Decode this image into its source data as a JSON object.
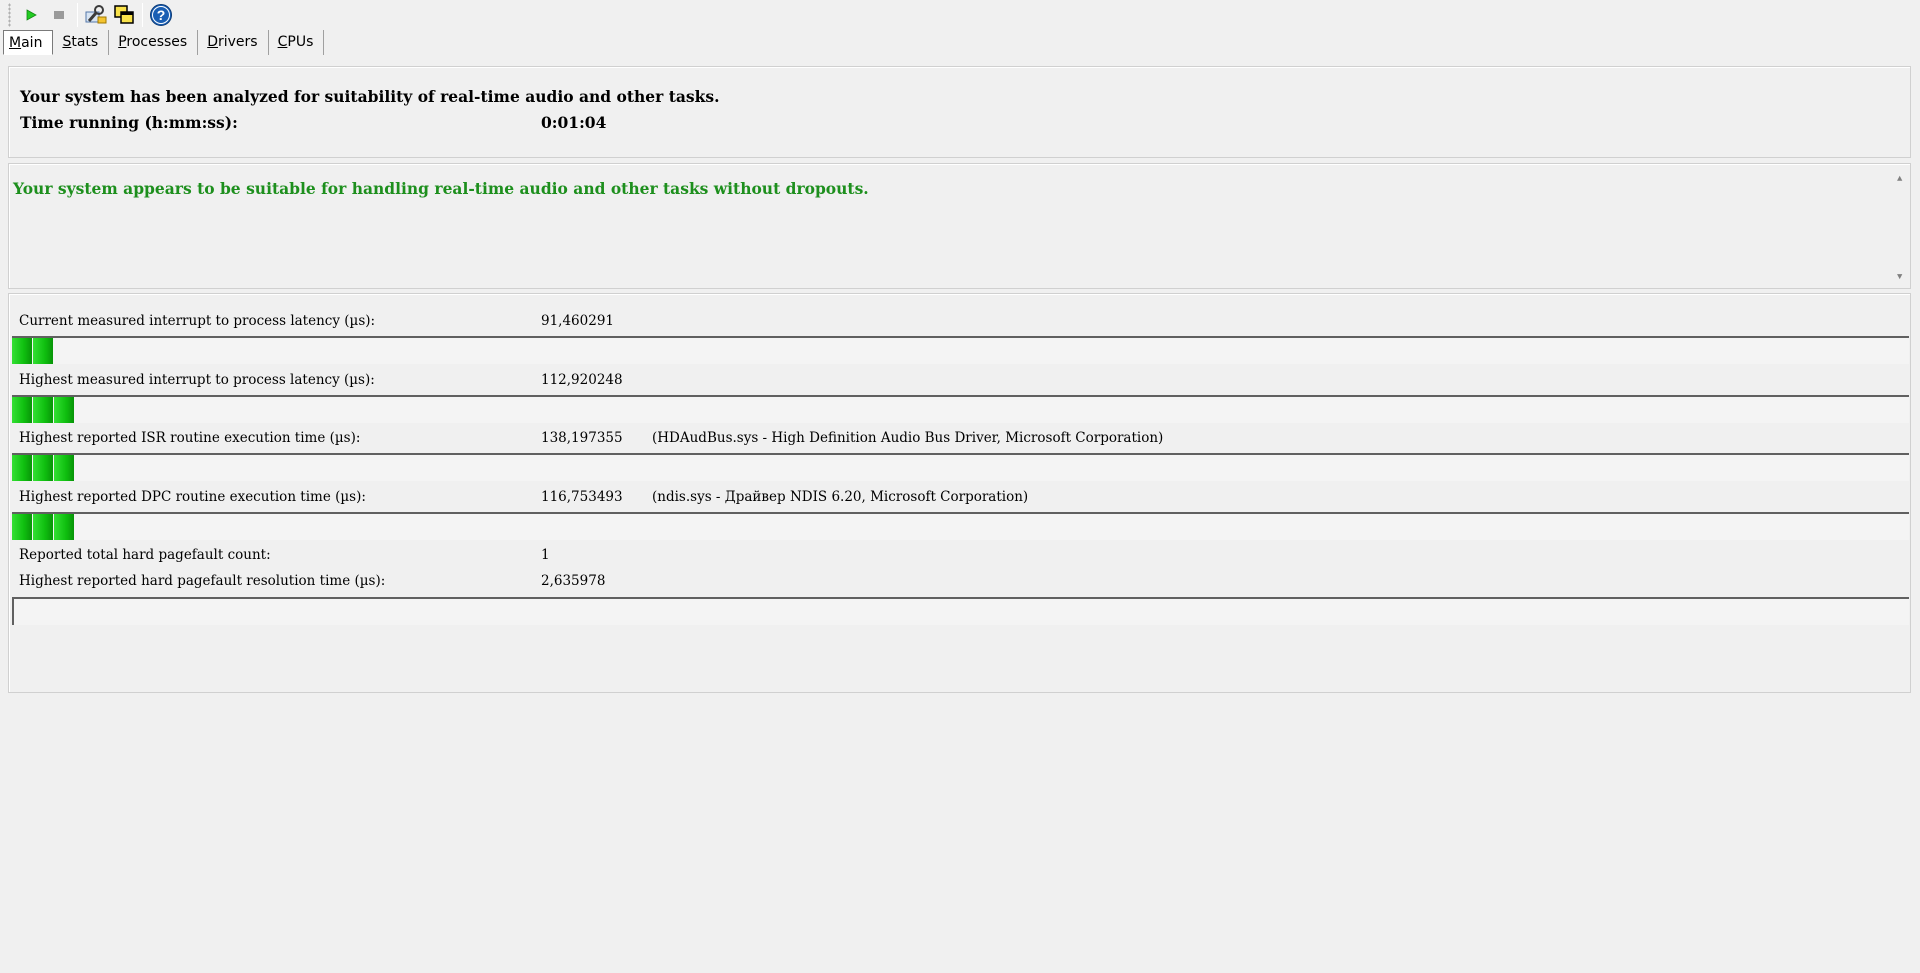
{
  "toolbar": {
    "buttons": [
      {
        "name": "start-icon",
        "color": "#22aa22"
      },
      {
        "name": "stop-icon",
        "color": "#909090"
      },
      {
        "name": "tools-icon"
      },
      {
        "name": "windows-icon"
      },
      {
        "name": "help-icon",
        "color": "#1a5fb4"
      }
    ]
  },
  "tabs": [
    {
      "key": "M",
      "rest": "ain",
      "active": true
    },
    {
      "key": "S",
      "rest": "tats"
    },
    {
      "key": "P",
      "rest": "rocesses"
    },
    {
      "key": "D",
      "rest": "rivers"
    },
    {
      "key": "C",
      "rest": "PUs"
    }
  ],
  "summary": {
    "line1": "Your system has been analyzed for suitability of real-time audio and other tasks.",
    "time_label": "Time running (h:mm:ss):",
    "time_value": "0:01:04"
  },
  "verdict": {
    "text": "Your system appears to be suitable for handling real-time audio and other tasks without dropouts.",
    "color": "#1d8f1d"
  },
  "metrics": [
    {
      "label": "Current measured interrupt to process latency (µs):",
      "value": "91,460291",
      "detail": "",
      "bar_segments": 2
    },
    {
      "label": "Highest measured interrupt to process latency (µs):",
      "value": "112,920248",
      "detail": "",
      "bar_segments": 3
    },
    {
      "label": "Highest reported ISR routine execution time (µs):",
      "value": "138,197355",
      "detail": "(HDAudBus.sys - High Definition Audio Bus Driver, Microsoft Corporation)",
      "bar_segments": 3
    },
    {
      "label": "Highest reported DPC routine execution time (µs):",
      "value": "116,753493",
      "detail": "(ndis.sys - Драйвер NDIS 6.20, Microsoft Corporation)",
      "bar_segments": 3
    },
    {
      "label": "Reported total hard pagefault count:",
      "value": "1",
      "detail": ""
    },
    {
      "label": "Highest reported hard pagefault resolution time (µs):",
      "value": "2,635978",
      "detail": "",
      "bar_segments": 0
    }
  ]
}
